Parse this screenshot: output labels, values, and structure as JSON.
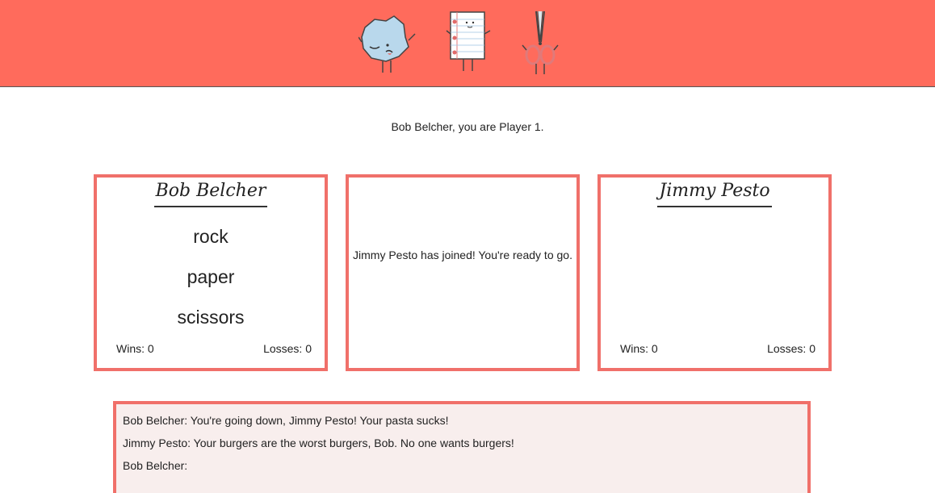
{
  "header": {
    "mascots": [
      {
        "name": "rock-mascot-icon"
      },
      {
        "name": "paper-mascot-icon"
      },
      {
        "name": "scissors-mascot-icon"
      }
    ],
    "bg_color": "#ff6b5c"
  },
  "status_text": "Bob Belcher, you are Player 1.",
  "player1": {
    "name": "Bob Belcher",
    "choices": [
      "rock",
      "paper",
      "scissors"
    ],
    "wins": "Wins: 0",
    "losses": "Losses: 0"
  },
  "middle": {
    "message": "Jimmy Pesto has joined! You're ready to go."
  },
  "player2": {
    "name": "Jimmy Pesto",
    "wins": "Wins: 0",
    "losses": "Losses: 0"
  },
  "chat": {
    "messages": [
      "Bob Belcher: You're going down, Jimmy Pesto! Your pasta sucks!",
      "Jimmy Pesto: Your burgers are the worst burgers, Bob. No one wants burgers!",
      "Bob Belcher:"
    ]
  },
  "colors": {
    "accent": "#f0706a",
    "chat_bg": "#f8eeed"
  }
}
